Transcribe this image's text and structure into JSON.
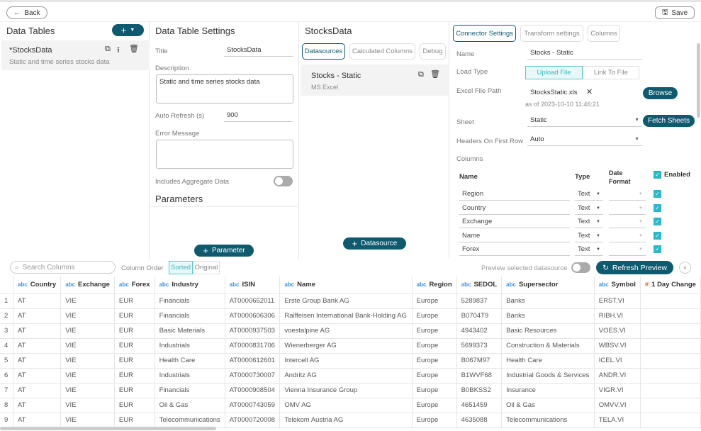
{
  "topbar": {
    "back": "Back",
    "save": "Save"
  },
  "data_tables": {
    "title": "Data Tables",
    "item_name": "*StocksData",
    "item_desc": "Static and time series stocks data"
  },
  "settings": {
    "title": "Data Table Settings",
    "title_label": "Title",
    "title_value": "StocksData",
    "desc_label": "Description",
    "desc_value": "Static and time series stocks data",
    "refresh_label": "Auto Refresh (s)",
    "refresh_value": "900",
    "error_label": "Error Message",
    "error_value": "",
    "aggregate_label": "Includes Aggregate Data",
    "parameters": "Parameters",
    "add_parameter": "Parameter"
  },
  "stocks": {
    "title": "StocksData",
    "tabs": [
      "Datasources",
      "Calculated Columns",
      "Debug"
    ],
    "ds_name": "Stocks - Static",
    "ds_type": "MS Excel",
    "add_datasource": "Datasource"
  },
  "connector": {
    "tabs": [
      "Connector Settings",
      "Transform settings",
      "Columns"
    ],
    "name_label": "Name",
    "name_value": "Stocks - Static",
    "load_label": "Load Type",
    "load_options": [
      "Upload File",
      "Link To File"
    ],
    "path_label": "Excel File Path",
    "file": "StocksStatic.xls",
    "as_of": "as of 2023-10-10 11:46:21",
    "browse": "Browse",
    "sheet_label": "Sheet",
    "sheet_value": "Static",
    "fetch": "Fetch Sheets",
    "headers_label": "Headers On First Row",
    "headers_value": "Auto",
    "columns_label": "Columns",
    "col_headers": {
      "name": "Name",
      "type": "Type",
      "date": "Date",
      "format": "Format",
      "enabled": "Enabled"
    },
    "columns": [
      {
        "name": "Region",
        "type": "Text"
      },
      {
        "name": "Country",
        "type": "Text"
      },
      {
        "name": "Exchange",
        "type": "Text"
      },
      {
        "name": "Name",
        "type": "Text"
      },
      {
        "name": "Forex",
        "type": "Text"
      }
    ]
  },
  "preview": {
    "search_placeholder": "Search Columns",
    "column_order": "Column Order",
    "sorted": "Sorted",
    "original": "Original",
    "preview_selected": "Preview selected datasource",
    "refresh": "Refresh Preview",
    "headers": [
      {
        "t": "abc",
        "n": "Country"
      },
      {
        "t": "abc",
        "n": "Exchange"
      },
      {
        "t": "abc",
        "n": "Forex"
      },
      {
        "t": "abc",
        "n": "Industry"
      },
      {
        "t": "abc",
        "n": "ISIN"
      },
      {
        "t": "abc",
        "n": "Name"
      },
      {
        "t": "abc",
        "n": "Region"
      },
      {
        "t": "abc",
        "n": "SEDOL"
      },
      {
        "t": "abc",
        "n": "Supersector"
      },
      {
        "t": "abc",
        "n": "Symbol"
      },
      {
        "t": "#",
        "n": "1 Day Change"
      }
    ],
    "rows": [
      [
        "1",
        "AT",
        "VIE",
        "EUR",
        "Financials",
        "AT0000652011",
        "Erste Group Bank AG",
        "Europe",
        "5289837",
        "Banks",
        "ERST.VI",
        ""
      ],
      [
        "2",
        "AT",
        "VIE",
        "EUR",
        "Financials",
        "AT0000606306",
        "Raiffeisen International Bank-Holding AG",
        "Europe",
        "B0704T9",
        "Banks",
        "RIBH.VI",
        ""
      ],
      [
        "3",
        "AT",
        "VIE",
        "EUR",
        "Basic Materials",
        "AT0000937503",
        "voestalpine AG",
        "Europe",
        "4943402",
        "Basic Resources",
        "VOES.VI",
        ""
      ],
      [
        "4",
        "AT",
        "VIE",
        "EUR",
        "Industrials",
        "AT0000831706",
        "Wienerberger AG",
        "Europe",
        "5699373",
        "Construction & Materials",
        "WBSV.VI",
        ""
      ],
      [
        "5",
        "AT",
        "VIE",
        "EUR",
        "Health Care",
        "AT0000612601",
        "Intercell AG",
        "Europe",
        "B067M97",
        "Health Care",
        "ICEL.VI",
        ""
      ],
      [
        "6",
        "AT",
        "VIE",
        "EUR",
        "Industrials",
        "AT0000730007",
        "Andritz AG",
        "Europe",
        "B1WVF68",
        "Industrial Goods & Services",
        "ANDR.VI",
        ""
      ],
      [
        "7",
        "AT",
        "VIE",
        "EUR",
        "Financials",
        "AT0000908504",
        "Vienna Insurance Group",
        "Europe",
        "B0BKSS2",
        "Insurance",
        "VIGR.VI",
        ""
      ],
      [
        "8",
        "AT",
        "VIE",
        "EUR",
        "Oil & Gas",
        "AT0000743059",
        "OMV AG",
        "Europe",
        "4651459",
        "Oil & Gas",
        "OMVV.VI",
        ""
      ],
      [
        "9",
        "AT",
        "VIE",
        "EUR",
        "Telecommunications",
        "AT0000720008",
        "Telekom Austria AG",
        "Europe",
        "4635088",
        "Telecommunications",
        "TELA.VI",
        ""
      ]
    ]
  }
}
